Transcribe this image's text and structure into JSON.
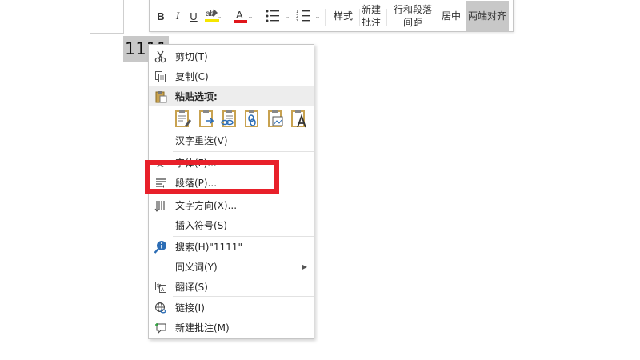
{
  "document": {
    "selected_text": "1111"
  },
  "mini_toolbar": {
    "bold": "B",
    "italic": "I",
    "underline": "U",
    "highlight_glyph": "ab",
    "font_color_glyph": "A",
    "style": "样式",
    "new_comment_line1": "新建",
    "new_comment_line2": "批注",
    "spacing_line1": "行和段落",
    "spacing_line2": "间距",
    "center": "居中",
    "justify": "两端对齐",
    "colors": {
      "highlight": "#f5e600",
      "font_color": "#e0161b"
    }
  },
  "context_menu": {
    "cut": "剪切(T)",
    "copy": "复制(C)",
    "paste_options": "粘贴选项:",
    "reconvert": "汉字重选(V)",
    "font": "字体(F)...",
    "paragraph": "段落(P)...",
    "text_direction": "文字方向(X)...",
    "insert_symbol": "插入符号(S)",
    "search": "搜索(H)\"1111\"",
    "synonyms": "同义词(Y)",
    "translate": "翻译(S)",
    "link": "链接(I)",
    "new_comment": "新建批注(M)"
  },
  "annotation": {
    "highlight_color": "#e8202a"
  }
}
